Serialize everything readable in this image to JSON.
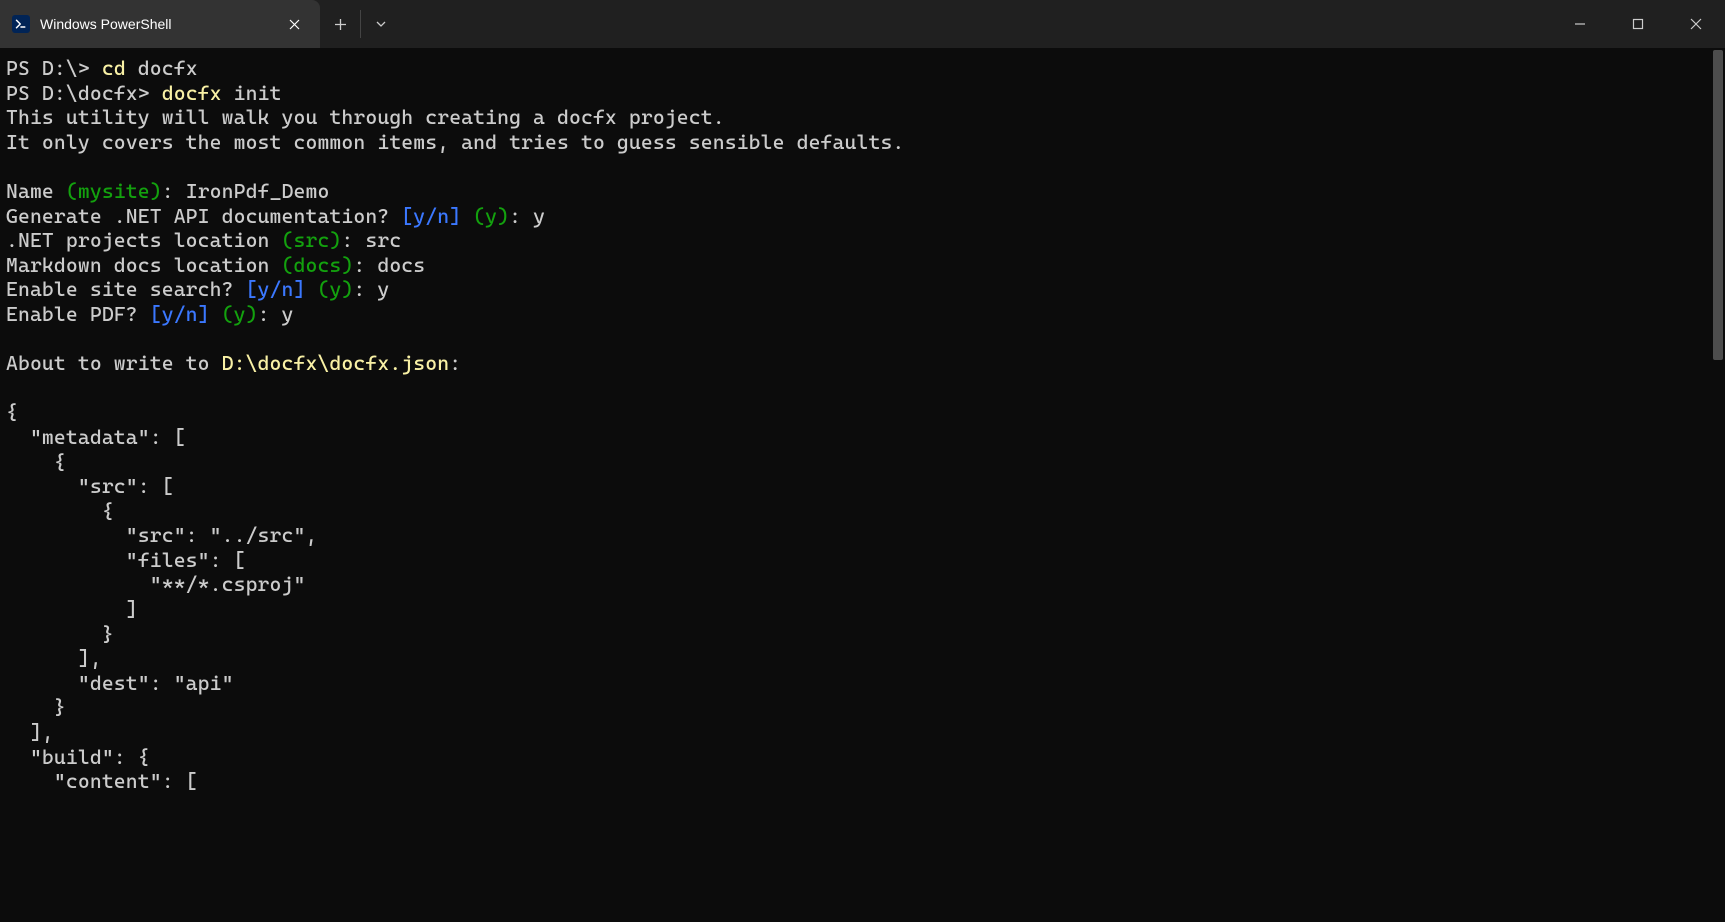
{
  "tab": {
    "title": "Windows PowerShell"
  },
  "term": {
    "line1_prompt": "PS D:\\> ",
    "line1_cmd1": "cd ",
    "line1_cmd2": "docfx",
    "line2_prompt": "PS D:\\docfx> ",
    "line2_cmd1": "docfx ",
    "line2_cmd2": "init",
    "line3": "This utility will walk you through creating a docfx project.",
    "line4": "It only covers the most common items, and tries to guess sensible defaults.",
    "blank": "",
    "name_label": "Name ",
    "name_default": "(mysite)",
    "name_colon": ": ",
    "name_value": "IronPdf_Demo",
    "gen_label": "Generate .NET API documentation? ",
    "yn": "[y/n]",
    "sp": " ",
    "y_default": "(y)",
    "colon_y": ": y",
    "proj_label": ".NET projects location ",
    "proj_default": "(src)",
    "proj_value": ": src",
    "md_label": "Markdown docs location ",
    "md_default": "(docs)",
    "md_value": ": docs",
    "search_label": "Enable site search? ",
    "pdf_label": "Enable PDF? ",
    "about_prefix": "About to write to ",
    "about_path": "D:\\docfx\\docfx.json",
    "about_colon": ":",
    "json01": "{",
    "json02": "  \"metadata\": [",
    "json03": "    {",
    "json04": "      \"src\": [",
    "json05": "        {",
    "json06": "          \"src\": \"../src\",",
    "json07": "          \"files\": [",
    "json08": "            \"**/*.csproj\"",
    "json09": "          ]",
    "json10": "        }",
    "json11": "      ],",
    "json12": "      \"dest\": \"api\"",
    "json13": "    }",
    "json14": "  ],",
    "json15": "  \"build\": {",
    "json16": "    \"content\": ["
  }
}
